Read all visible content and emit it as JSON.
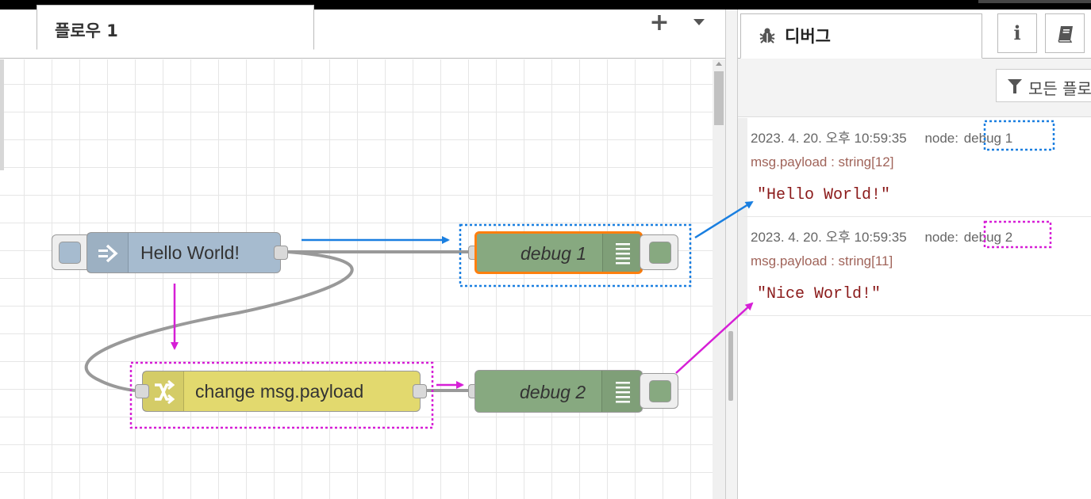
{
  "workspace": {
    "flow_tab": "플로우 1",
    "add_tab": "+",
    "tab_menu_icon": "caret-down-icon"
  },
  "nodes": {
    "inject": {
      "label": "Hello World!",
      "color": "#a6bbcf",
      "icon": "arrow-right-icon"
    },
    "change": {
      "label": "change msg.payload",
      "color": "#e2d96e",
      "icon": "shuffle-icon"
    },
    "debug1": {
      "label": "debug 1",
      "color": "#87a980",
      "icon": "list-icon"
    },
    "debug2": {
      "label": "debug 2",
      "color": "#87a980",
      "icon": "list-icon"
    }
  },
  "sidebar": {
    "tab_label": "디버그",
    "tab_icon": "bug-icon",
    "info_button": "i",
    "book_icon": "book-icon",
    "filter_label": "모든 플로",
    "messages": [
      {
        "date": "2023. 4. 20. 오후 10:59:35",
        "node_prefix": "node:",
        "node_name": "debug 1",
        "topic": "msg.payload : string[12]",
        "value": "\"Hello World!\""
      },
      {
        "date": "2023. 4. 20. 오후 10:59:35",
        "node_prefix": "node:",
        "node_name": "debug 2",
        "topic": "msg.payload : string[11]",
        "value": "\"Nice World!\""
      }
    ]
  },
  "colors": {
    "annotation_blue": "#1a7fe0",
    "annotation_magenta": "#d61fd6",
    "selected_outline": "#ff7f0e"
  }
}
